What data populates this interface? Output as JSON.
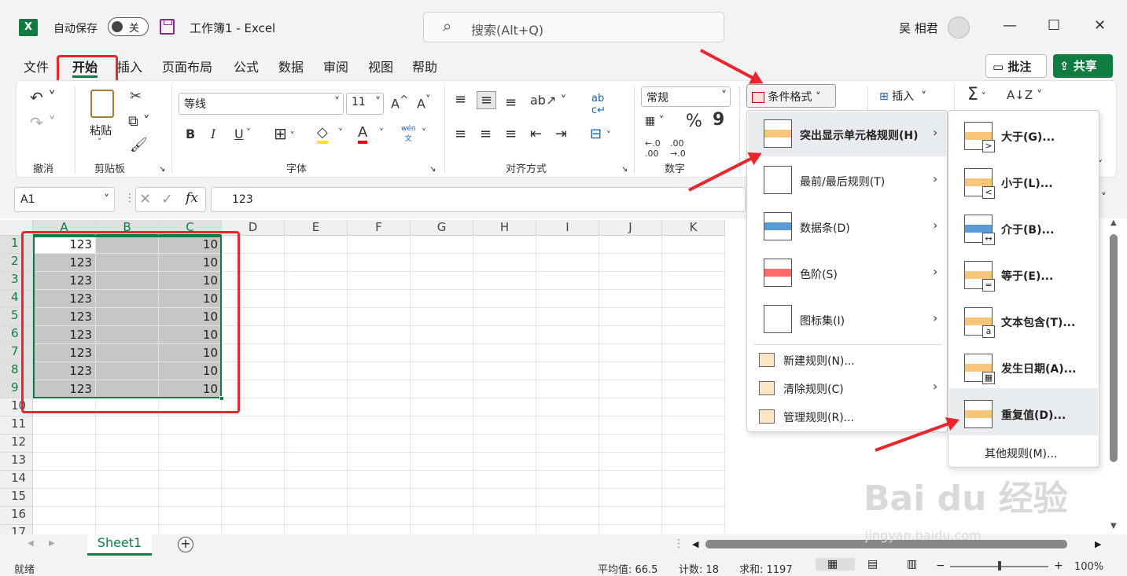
{
  "title_bar": {
    "autosave_label": "自动保存",
    "autosave_state": "关",
    "doc_title": "工作簿1  -  Excel",
    "search_placeholder": "搜索(Alt+Q)",
    "user_name": "吴 相君"
  },
  "menu_tabs": [
    "文件",
    "开始",
    "插入",
    "页面布局",
    "公式",
    "数据",
    "审阅",
    "视图",
    "帮助"
  ],
  "comment_btn": "批注",
  "share_btn": "共享",
  "ribbon": {
    "undo_group": "撤消",
    "clipboard": {
      "paste": "粘贴",
      "label": "剪贴板"
    },
    "font": {
      "name": "等线",
      "size": "11",
      "grow": "A^",
      "shrink": "A˅",
      "label": "字体",
      "bold": "B",
      "italic": "I",
      "underline": "U",
      "phonetic_top": "wén",
      "phonetic_bot": "文"
    },
    "alignment": {
      "label": "对齐方式"
    },
    "number": {
      "format": "常规",
      "label": "数字",
      "percent": "%",
      "comma": "9"
    },
    "cond_format": "条件格式",
    "insert": "插入",
    "sum": "Σ",
    "sort": "A↓Z"
  },
  "formula_bar": {
    "name_box": "A1",
    "fx": "fx",
    "value": "123"
  },
  "columns": [
    "A",
    "B",
    "C",
    "D",
    "E",
    "F",
    "G",
    "H",
    "I",
    "J",
    "K"
  ],
  "rows": [
    "1",
    "2",
    "3",
    "4",
    "5",
    "6",
    "7",
    "8",
    "9",
    "10",
    "11",
    "12",
    "13",
    "14",
    "15",
    "16",
    "17"
  ],
  "cells_a": [
    "123",
    "123",
    "123",
    "123",
    "123",
    "123",
    "123",
    "123",
    "123"
  ],
  "cells_c": [
    "10",
    "10",
    "10",
    "10",
    "10",
    "10",
    "10",
    "10",
    "10"
  ],
  "cf_menu": {
    "items": [
      {
        "label": "突出显示单元格规则(H)",
        "icon": "highlight-rules-icon"
      },
      {
        "label": "最前/最后规则(T)",
        "icon": "top-bottom-icon"
      },
      {
        "label": "数据条(D)",
        "icon": "data-bars-icon"
      },
      {
        "label": "色阶(S)",
        "icon": "color-scales-icon"
      },
      {
        "label": "图标集(I)",
        "icon": "icon-sets-icon"
      }
    ],
    "small_items": [
      "新建规则(N)...",
      "清除规则(C)",
      "管理规则(R)..."
    ]
  },
  "sub_menu": {
    "items": [
      "大于(G)...",
      "小于(L)...",
      "介于(B)...",
      "等于(E)...",
      "文本包含(T)...",
      "发生日期(A)...",
      "重复值(D)..."
    ],
    "more": "其他规则(M)..."
  },
  "sheet_tab": "Sheet1",
  "status": {
    "ready": "就绪",
    "avg": "平均值: 66.5",
    "count": "计数: 18",
    "sum": "求和: 1197",
    "zoom": "100%"
  },
  "watermark": "Bai du 经验",
  "watermark_url": "jingyan.baidu.com",
  "colors": {
    "accent": "#107c41",
    "highlight_red": "#e8262b",
    "selection": "#c6c6c6"
  }
}
